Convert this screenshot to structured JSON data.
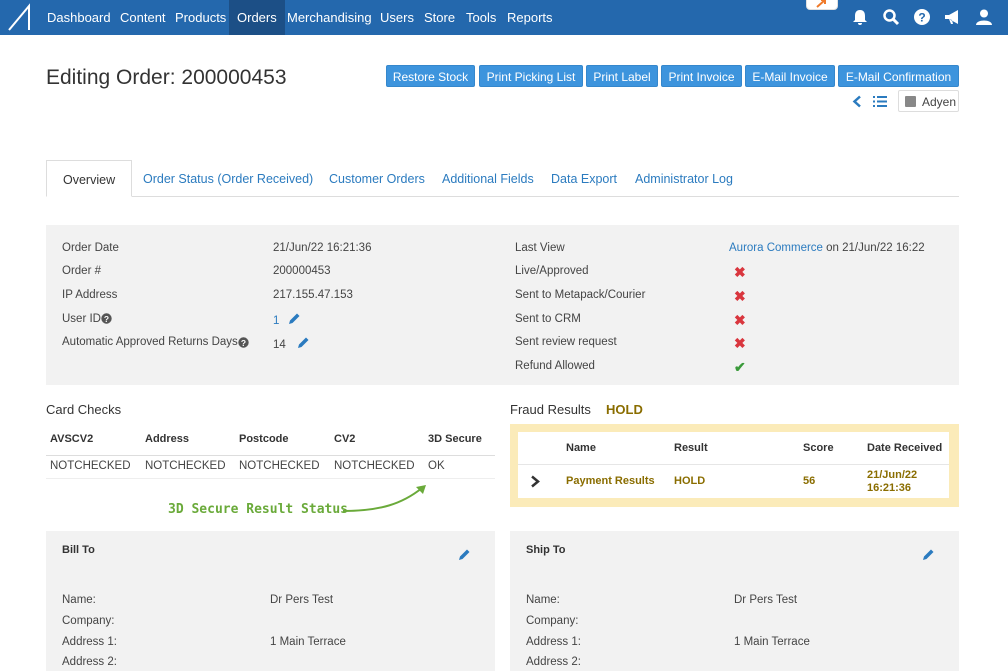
{
  "nav": {
    "items": [
      "Dashboard",
      "Content",
      "Products",
      "Orders",
      "Merchandising",
      "Users",
      "Store",
      "Tools",
      "Reports"
    ],
    "active": "Orders"
  },
  "page": {
    "title": "Editing Order: 200000453",
    "actions": [
      "Restore Stock",
      "Print Picking List",
      "Print Label",
      "Print Invoice",
      "E-Mail Invoice",
      "E-Mail Confirmation"
    ],
    "payment_provider": "Adyen"
  },
  "tabs": [
    "Overview",
    "Order Status (Order Received)",
    "Customer Orders",
    "Additional Fields",
    "Data Export",
    "Administrator Log"
  ],
  "overview": {
    "left": [
      {
        "label": "Order Date",
        "value": "21/Jun/22 16:21:36"
      },
      {
        "label": "Order #",
        "value": "200000453"
      },
      {
        "label": "IP Address",
        "value": "217.155.47.153"
      },
      {
        "label": "User ID",
        "value": "1"
      },
      {
        "label": "Automatic Approved Returns Days",
        "value": "14"
      }
    ],
    "last_view_label": "Last View",
    "last_view_link": "Aurora Commerce",
    "last_view_suffix": " on 21/Jun/22 16:22",
    "flags": [
      {
        "label": "Live/Approved",
        "state": "no"
      },
      {
        "label": "Sent to Metapack/Courier",
        "state": "no"
      },
      {
        "label": "Sent to CRM",
        "state": "no"
      },
      {
        "label": "Sent review request",
        "state": "no"
      },
      {
        "label": "Refund Allowed",
        "state": "yes"
      }
    ]
  },
  "card_checks": {
    "title": "Card Checks",
    "headers": [
      "AVSCV2",
      "Address",
      "Postcode",
      "CV2",
      "3D Secure"
    ],
    "values": [
      "NOTCHECKED",
      "NOTCHECKED",
      "NOTCHECKED",
      "NOTCHECKED",
      "OK"
    ],
    "annotation": "3D Secure Result Status"
  },
  "fraud": {
    "title": "Fraud Results",
    "status": "HOLD",
    "headers": [
      "Name",
      "Result",
      "Score",
      "Date Received"
    ],
    "row": {
      "name": "Payment Results",
      "result": "HOLD",
      "score": "56",
      "date_line1": "21/Jun/22",
      "date_line2": "16:21:36"
    }
  },
  "bill_to": {
    "title": "Bill To",
    "rows": [
      {
        "label": "Name:",
        "value": "Dr Pers Test"
      },
      {
        "label": "Company:",
        "value": ""
      },
      {
        "label": "Address 1:",
        "value": "1 Main Terrace"
      },
      {
        "label": "Address 2:",
        "value": ""
      }
    ]
  },
  "ship_to": {
    "title": "Ship To",
    "rows": [
      {
        "label": "Name:",
        "value": "Dr Pers Test"
      },
      {
        "label": "Company:",
        "value": ""
      },
      {
        "label": "Address 1:",
        "value": "1 Main Terrace"
      },
      {
        "label": "Address 2:",
        "value": ""
      }
    ]
  },
  "colors": {
    "nav": "#2468ad",
    "accent": "#3d94dd",
    "annotation": "#6aaa3a",
    "hold": "#8a6d00"
  }
}
